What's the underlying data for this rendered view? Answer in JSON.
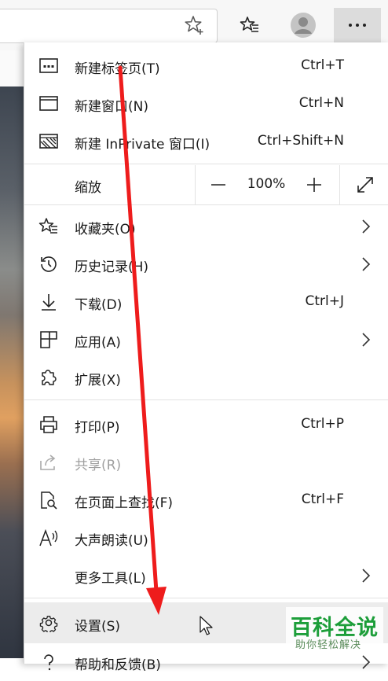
{
  "toolbar": {
    "favorites_add_icon": "star-plus-icon",
    "favorites_icon": "favorites-list-icon",
    "profile_icon": "profile-icon",
    "more_icon": "more-icon"
  },
  "menu": {
    "new_tab": {
      "label": "新建标签页(T)",
      "shortcut": "Ctrl+T"
    },
    "new_window": {
      "label": "新建窗口(N)",
      "shortcut": "Ctrl+N"
    },
    "new_inprivate": {
      "label": "新建 InPrivate 窗口(I)",
      "shortcut": "Ctrl+Shift+N"
    },
    "zoom": {
      "label": "缩放",
      "minus": "−",
      "value": "100%",
      "plus": "+"
    },
    "favorites": {
      "label": "收藏夹(O)"
    },
    "history": {
      "label": "历史记录(H)"
    },
    "downloads": {
      "label": "下载(D)",
      "shortcut": "Ctrl+J"
    },
    "apps": {
      "label": "应用(A)"
    },
    "extensions": {
      "label": "扩展(X)"
    },
    "print": {
      "label": "打印(P)",
      "shortcut": "Ctrl+P"
    },
    "share": {
      "label": "共享(R)"
    },
    "find": {
      "label": "在页面上查找(F)",
      "shortcut": "Ctrl+F"
    },
    "read_aloud": {
      "label": "大声朗读(U)"
    },
    "more_tools": {
      "label": "更多工具(L)"
    },
    "settings": {
      "label": "设置(S)"
    },
    "help": {
      "label": "帮助和反馈(B)"
    }
  },
  "watermark": {
    "title": "百科全说",
    "subtitle": "助你轻松解决"
  },
  "colors": {
    "arrow": "#ee1c1c",
    "menu_hover": "#ececec",
    "watermark": "#1d9e3a"
  }
}
